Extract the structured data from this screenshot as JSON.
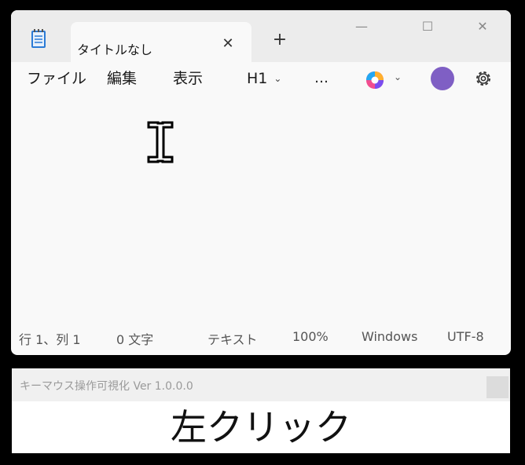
{
  "notepad": {
    "tab_title": "タイトルなし",
    "menu": {
      "file": "ファイル",
      "edit": "編集",
      "view": "表示"
    },
    "heading_dropdown": "H1",
    "more": "…",
    "status": {
      "position": "行 1、列 1",
      "char_count": "0 文字",
      "format": "テキスト",
      "zoom": "100%",
      "line_ending": "Windows",
      "encoding": "UTF-8"
    },
    "avatar_color": "#7f5fc4"
  },
  "visualizer": {
    "title": "キーマウス操作可視化 Ver 1.0.0.0",
    "display_text": "左クリック"
  }
}
